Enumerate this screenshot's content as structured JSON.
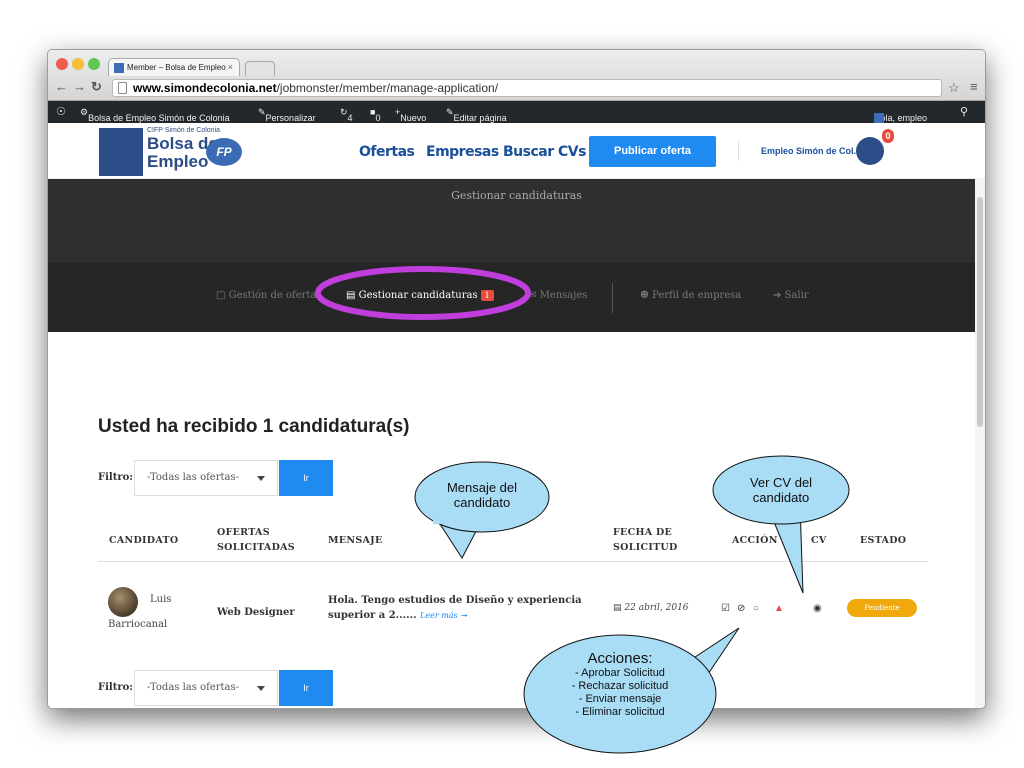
{
  "browser": {
    "tab_title": "Member – Bolsa de Empleo",
    "tab_close": "×",
    "url_domain": "www.simondecolonia.net",
    "url_path": "/jobmonster/member/manage-application/"
  },
  "admin_bar": {
    "site_name": "Bolsa de Empleo Simón de Colonia",
    "customize": "Personalizar",
    "updates": "4",
    "comments": "0",
    "new": "Nuevo",
    "edit_page": "Editar página",
    "greeting": "Hola, empleo"
  },
  "header": {
    "logo_cifp": "CIFP Simón de Colonia",
    "logo_bolsa": "Bolsa de",
    "logo_empleo": "Empleo",
    "logo_fp": "FP",
    "nav": [
      "Ofertas",
      "Empresas",
      "Buscar CVs"
    ],
    "publish_button": "Publicar oferta",
    "company_name": "Empleo Simón de Col...",
    "notification_count": "0"
  },
  "banner": {
    "title": "Gestionar candidaturas"
  },
  "subnav": {
    "gestion_ofertas": "Gestión de ofertas",
    "gestionar_candidaturas": "Gestionar candidaturas",
    "candidaturas_badge": "1",
    "mensajes": "Mensajes",
    "perfil": "Perfil de empresa",
    "salir": "Salir"
  },
  "main": {
    "heading": "Usted ha recibido 1 candidatura(s)",
    "filter_label": "Filtro:",
    "filter_value": "-Todas las ofertas-",
    "filter_button": "Ir"
  },
  "table": {
    "columns": {
      "candidato": "CANDIDATO",
      "ofertas_1": "OFERTAS",
      "ofertas_2": "SOLICITADAS",
      "mensaje": "MENSAJE",
      "fecha_1": "FECHA DE",
      "fecha_2": "SOLICITUD",
      "accion": "ACCIÓN",
      "cv": "CV",
      "estado": "ESTADO"
    },
    "row": {
      "name_first": "Luis",
      "name_last": "Barriocanal",
      "job": "Web Designer",
      "message_1": "Hola. Tengo estudios de Diseño y experiencia",
      "message_2": "superior a 2......",
      "read_more": "Leer más ➞",
      "date": "22 abril, 2016",
      "status": "Pendiente"
    }
  },
  "annotations": {
    "mensaje_1": "Mensaje del",
    "mensaje_2": "candidato",
    "cv_1": "Ver CV del",
    "cv_2": "candidato",
    "acciones_title": "Acciones:",
    "acciones_1": "- Aprobar Solicitud",
    "acciones_2": "- Rechazar solicitud",
    "acciones_3": "- Enviar mensaje",
    "acciones_4": "- Eliminar solicitud"
  },
  "colors": {
    "accent_blue": "#1f8aef",
    "status_orange": "#f0a80d",
    "highlight_purple": "#c03fdc",
    "callout_fill": "#a9dcf5"
  }
}
